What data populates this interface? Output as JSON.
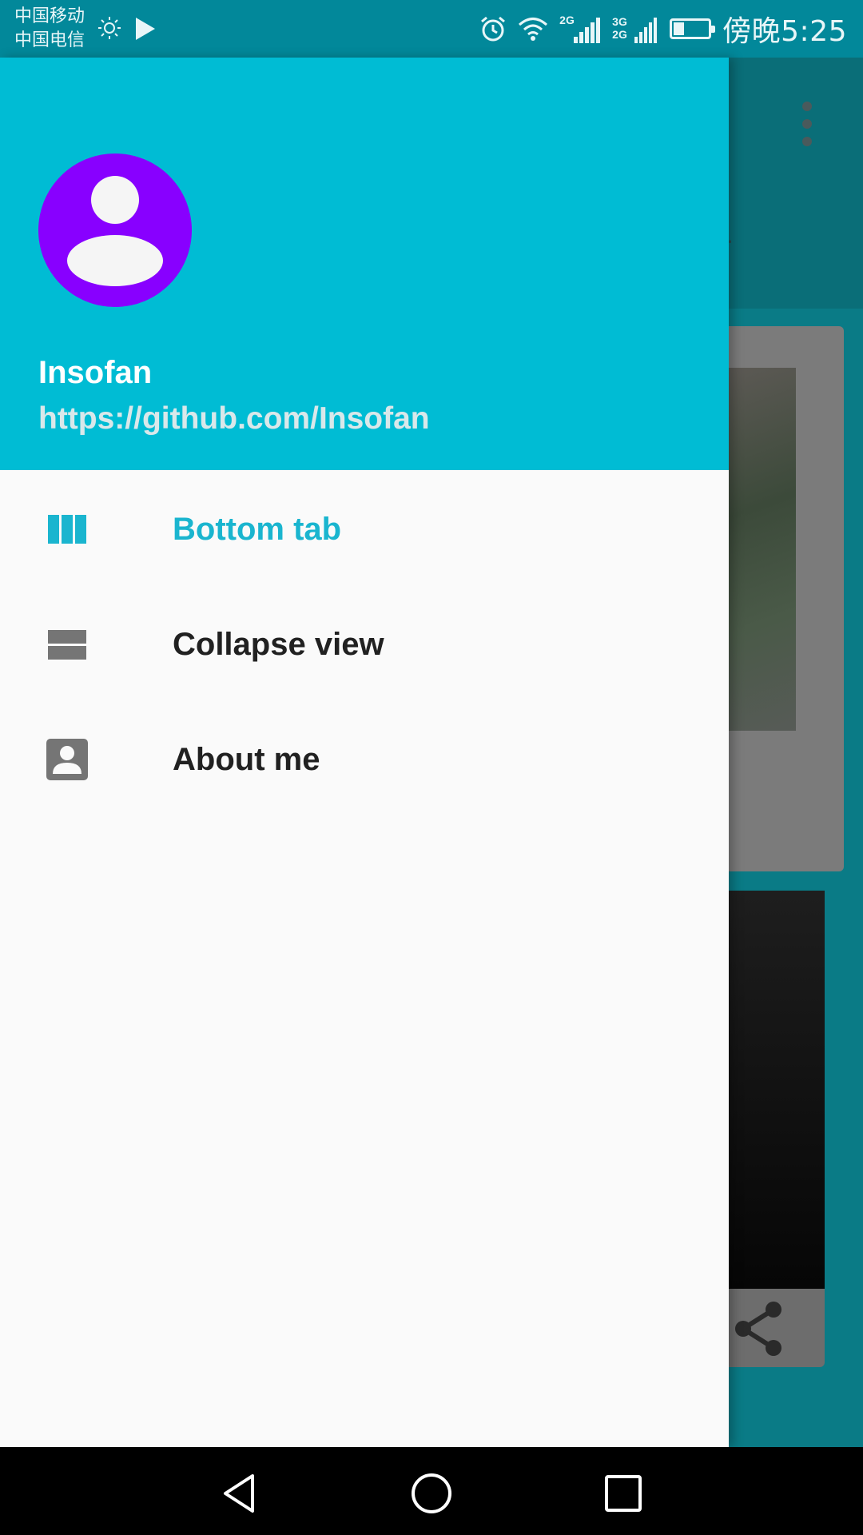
{
  "status_bar": {
    "carrier_1": "中国移动",
    "carrier_2": "中国电信",
    "network_2g": "2G",
    "network_3g": "3G",
    "network_2g_b": "2G",
    "battery_level": 0.3,
    "time": "傍晚5:25"
  },
  "background_app": {
    "tab_partial_text": "er",
    "icons": [
      "more-vert-icon",
      "share-icon"
    ]
  },
  "drawer": {
    "header": {
      "name": "Insofan",
      "url": "https://github.com/Insofan",
      "avatar_color": "#8800ff",
      "header_color": "#00bcd4"
    },
    "items": [
      {
        "label": "Bottom tab",
        "icon": "view-column-icon",
        "active": true
      },
      {
        "label": "Collapse view",
        "icon": "view-stream-icon",
        "active": false
      },
      {
        "label": "About me",
        "icon": "contact-icon",
        "active": false
      }
    ],
    "active_color": "#1ab5cf"
  },
  "nav_bar": {
    "icons": [
      "back-icon",
      "home-icon",
      "recents-icon"
    ]
  }
}
